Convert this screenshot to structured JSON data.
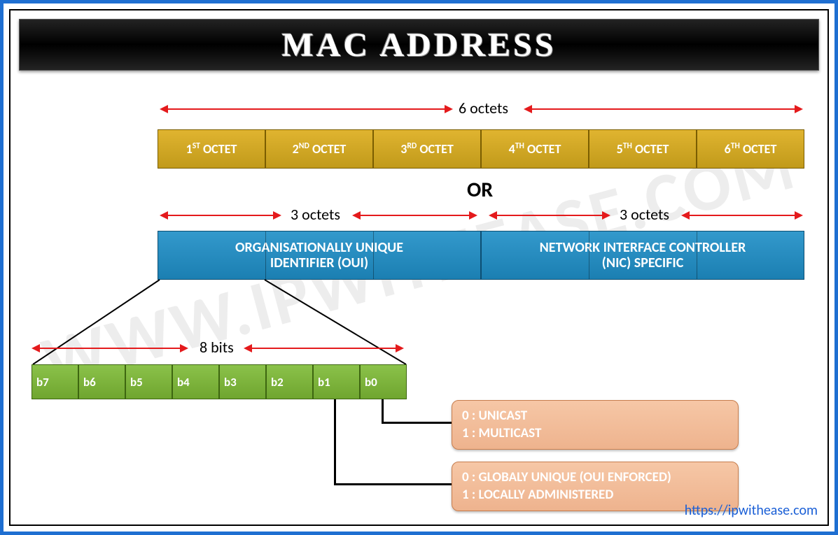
{
  "title": "MAC ADDRESS",
  "watermark": "WWW.IPWITHEASE.COM",
  "footer_url": "https://ipwithease.com",
  "range_labels": {
    "six_octets": "6 octets",
    "three_octets_left": "3 octets",
    "three_octets_right": "3 octets",
    "eight_bits": "8 bits",
    "or": "OR"
  },
  "octets": [
    {
      "ord": "1",
      "sup": "ST",
      "word": "OCTET"
    },
    {
      "ord": "2",
      "sup": "ND",
      "word": "OCTET"
    },
    {
      "ord": "3",
      "sup": "RD",
      "word": "OCTET"
    },
    {
      "ord": "4",
      "sup": "TH",
      "word": "OCTET"
    },
    {
      "ord": "5",
      "sup": "TH",
      "word": "OCTET"
    },
    {
      "ord": "6",
      "sup": "TH",
      "word": "OCTET"
    }
  ],
  "sections": {
    "left_line1": "ORGANISATIONALLY UNIQUE",
    "left_line2": "IDENTIFIER (OUI)",
    "right_line1": "NETWORK INTERFACE CONTROLLER",
    "right_line2": "(NIC) SPECIFIC"
  },
  "bits": [
    "b7",
    "b6",
    "b5",
    "b4",
    "b3",
    "b2",
    "b1",
    "b0"
  ],
  "meanings": {
    "b0_line1": "0 : UNICAST",
    "b0_line2": "1 : MULTICAST",
    "b1_line1": "0 : GLOBALY UNIQUE (OUI ENFORCED)",
    "b1_line2": "1 : LOCALLY ADMINISTERED"
  }
}
